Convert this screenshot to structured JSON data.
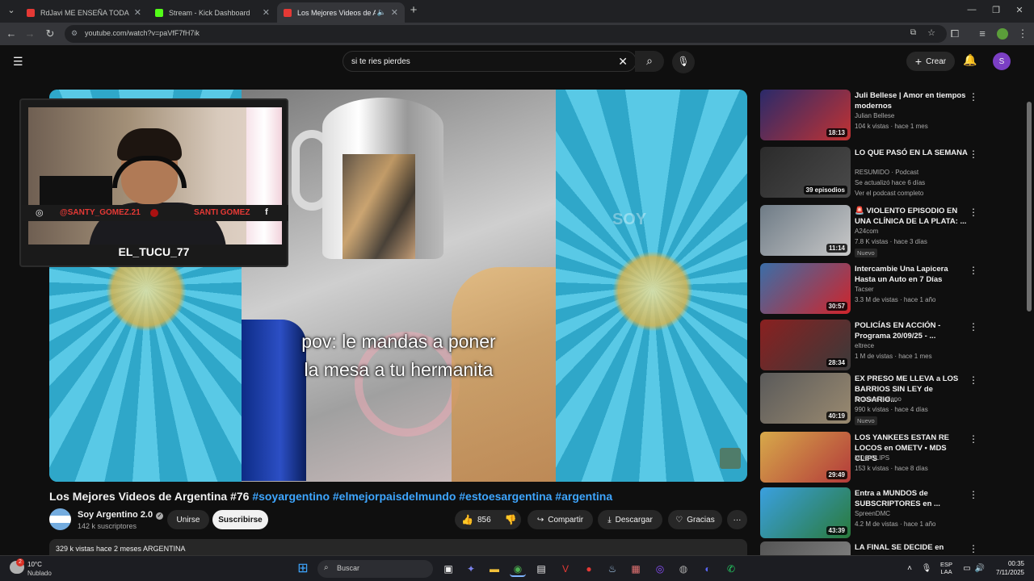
{
  "tabs": [
    {
      "title": "RdJavi ME ENSEÑA TODA SU C",
      "favicon_color": "#e53935",
      "active": false
    },
    {
      "title": "Stream - Kick Dashboard",
      "favicon_color": "#53fc18",
      "active": false
    },
    {
      "title": "Los Mejores Videos de Arge",
      "favicon_color": "#e53935",
      "active": true
    }
  ],
  "address_bar": {
    "url": "youtube.com/watch?v=paVfF7fH7ik"
  },
  "search": {
    "query": "si te ries pierdes"
  },
  "header": {
    "create_label": "Crear",
    "avatar_letter": "S"
  },
  "facecam": {
    "nickname": "EL_TUCU_77",
    "instagram": "@SANTY_GOMEZ.21",
    "name": "SANTI GOMEZ"
  },
  "player": {
    "caption": "pov: le mandas a poner\nla mesa a tu hermanita",
    "side_text": "SOY"
  },
  "video": {
    "title": "Los Mejores Videos de Argentina #76",
    "hashtags": "#soyargentino #elmejorpaisdelmundo #estoesargentina #argentina",
    "channel": "Soy Argentino 2.0",
    "subscribers": "142 k suscriptores",
    "join_label": "Unirse",
    "subscribe_label": "Suscribirse",
    "likes": "856",
    "share_label": "Compartir",
    "download_label": "Descargar",
    "thanks_label": "Gracias",
    "description": "329 k vistas  hace 2 meses  ARGENTINA"
  },
  "recommendations": [
    {
      "title": "Juli Bellese | Amor en tiempos modernos",
      "channel": "Julian Bellese",
      "meta": "104 k vistas · hace 1 mes",
      "duration": "18:13",
      "thumb": [
        "#2a2a6a",
        "#c23232"
      ],
      "badge": ""
    },
    {
      "title": "LO QUE PASÓ EN LA SEMANA",
      "channel": "RESUMIDO · Podcast",
      "meta": "Se actualizó hace 6 días",
      "extra": "Ver el podcast completo",
      "duration": "39 episodios",
      "thumb": [
        "#2b2b2b",
        "#4a4a4a"
      ],
      "badge": ""
    },
    {
      "title": "🚨 VIOLENTO EPISODIO EN UNA CLÍNICA DE LA PLATA: ...",
      "channel": "A24com",
      "meta": "7.8 K vistas · hace 3 días",
      "duration": "11:14",
      "thumb": [
        "#6e7b86",
        "#c9c9c9"
      ],
      "badge": "Nuevo"
    },
    {
      "title": "Intercambie Una Lapicera Hasta un Auto en 7 Días",
      "channel": "Tacser",
      "meta": "3.3 M de vistas · hace 1 año",
      "duration": "30:57",
      "thumb": [
        "#3a6ea8",
        "#d0242a"
      ],
      "badge": ""
    },
    {
      "title": "POLICÍAS EN ACCIÓN - Programa 20/09/25 - ...",
      "channel": "eltrece",
      "meta": "1 M de vistas · hace 1 mes",
      "duration": "28:34",
      "thumb": [
        "#8a2020",
        "#3a3a3a"
      ],
      "badge": ""
    },
    {
      "title": "EX PRESO ME LLEVA a LOS BARRIOS SIN LEY de ROSARIO...",
      "channel": "Zazza el italiano",
      "meta": "990 k vistas · hace 4 días",
      "duration": "40:19",
      "thumb": [
        "#5a5a5a",
        "#9a8a70"
      ],
      "badge": "Nuevo"
    },
    {
      "title": "LOS YANKEES ESTAN RE LOCOS en OMETV • MDS CLIPS",
      "channel": "MDS CLIPS",
      "meta": "153 k vistas · hace 8 días",
      "duration": "29:49",
      "thumb": [
        "#d7a94a",
        "#b33a3a"
      ],
      "badge": ""
    },
    {
      "title": "Entra a MUNDOS de SUBSCRIPTORES en ...",
      "channel": "SpreenDMC",
      "meta": "4.2 M de vistas · hace 1 año",
      "duration": "43:39",
      "thumb": [
        "#3aa0e0",
        "#2a7a3a"
      ],
      "badge": ""
    },
    {
      "title": "LA FINAL SE DECIDE en",
      "channel": "",
      "meta": "",
      "duration": "",
      "thumb": [
        "#555555",
        "#888888"
      ],
      "badge": ""
    }
  ],
  "taskbar": {
    "weather_temp": "10°C",
    "weather_desc": "Nublado",
    "weather_badge": "2",
    "search_placeholder": "Buscar",
    "lang_top": "ESP",
    "lang_bottom": "LAA",
    "time": "00:35",
    "date": "7/11/2025"
  },
  "colors": {
    "accent": "#3ea6ff",
    "bg": "#0f0f0f",
    "kick": "#53fc18",
    "youtube": "#e53935"
  }
}
